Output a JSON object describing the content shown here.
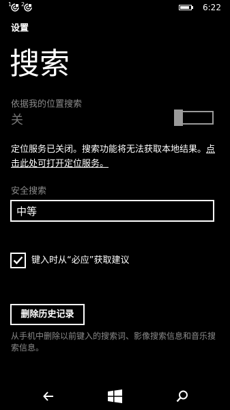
{
  "status_bar": {
    "sim1_number": "1",
    "sim2_number": "2",
    "sim1_icon": "sim-signal-icon",
    "sim2_icon": "sim-signal-icon",
    "battery_icon": "battery-icon",
    "time": "6:22"
  },
  "app": {
    "title": "设置"
  },
  "page": {
    "title": "搜索"
  },
  "location_search": {
    "label": "依据我的位置搜索",
    "value": "关",
    "toggle_on": false
  },
  "location_info": {
    "text": "定位服务已关闭。搜索功能将无法获取本地结果。",
    "link": "点击此处可打开定位服务。"
  },
  "safe_search": {
    "label": "安全搜索",
    "selected": "中等"
  },
  "suggestions": {
    "label": "键入时从“必应”获取建议",
    "checked": true
  },
  "history": {
    "button_label": "删除历史记录",
    "description": "从手机中删除以前键入的搜索词、影像搜索信息和音乐搜索信息。"
  },
  "nav": {
    "back_icon": "back-arrow-icon",
    "start_icon": "windows-logo-icon",
    "search_icon": "search-icon"
  },
  "colors": {
    "background": "#000000",
    "text": "#ffffff",
    "secondary_text": "#8a8a8a",
    "disabled": "#9a9a9a"
  }
}
